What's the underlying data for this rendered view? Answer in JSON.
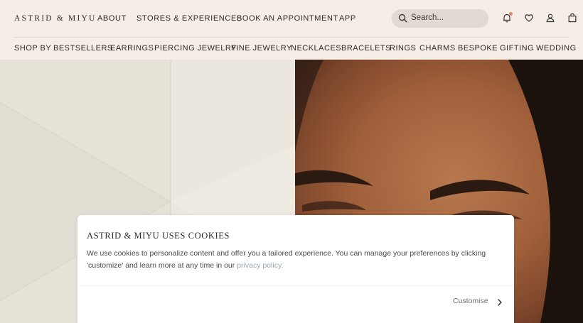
{
  "header": {
    "logo": "ASTRID & MIYU",
    "links": [
      "ABOUT",
      "STORES & EXPERIENCES",
      "BOOK AN APPOINTMENT",
      "APP"
    ],
    "search_placeholder": "Search...",
    "icons": [
      "bell-icon",
      "heart-icon",
      "user-icon",
      "bag-icon"
    ]
  },
  "nav": {
    "items": [
      "SHOP BY",
      "BESTSELLERS",
      "EARRINGS",
      "PIERCING JEWELRY",
      "FINE JEWELRY",
      "NECKLACES",
      "BRACELETS",
      "RINGS",
      "CHARMS",
      "BESPOKE",
      "GIFTING",
      "WEDDING"
    ]
  },
  "cookie": {
    "title": "ASTRID & MIYU USES COOKIES",
    "body": "We use cookies to personalize content and offer you a tailored experience. You can manage your preferences by clicking 'customize' and learn more at any time in our",
    "link_text": "privacy policy.",
    "customise_label": "Customise"
  },
  "colors": {
    "header_bg": "#f5ede6",
    "search_bg": "#e2d9d2",
    "link_muted": "#9aa8b4"
  }
}
